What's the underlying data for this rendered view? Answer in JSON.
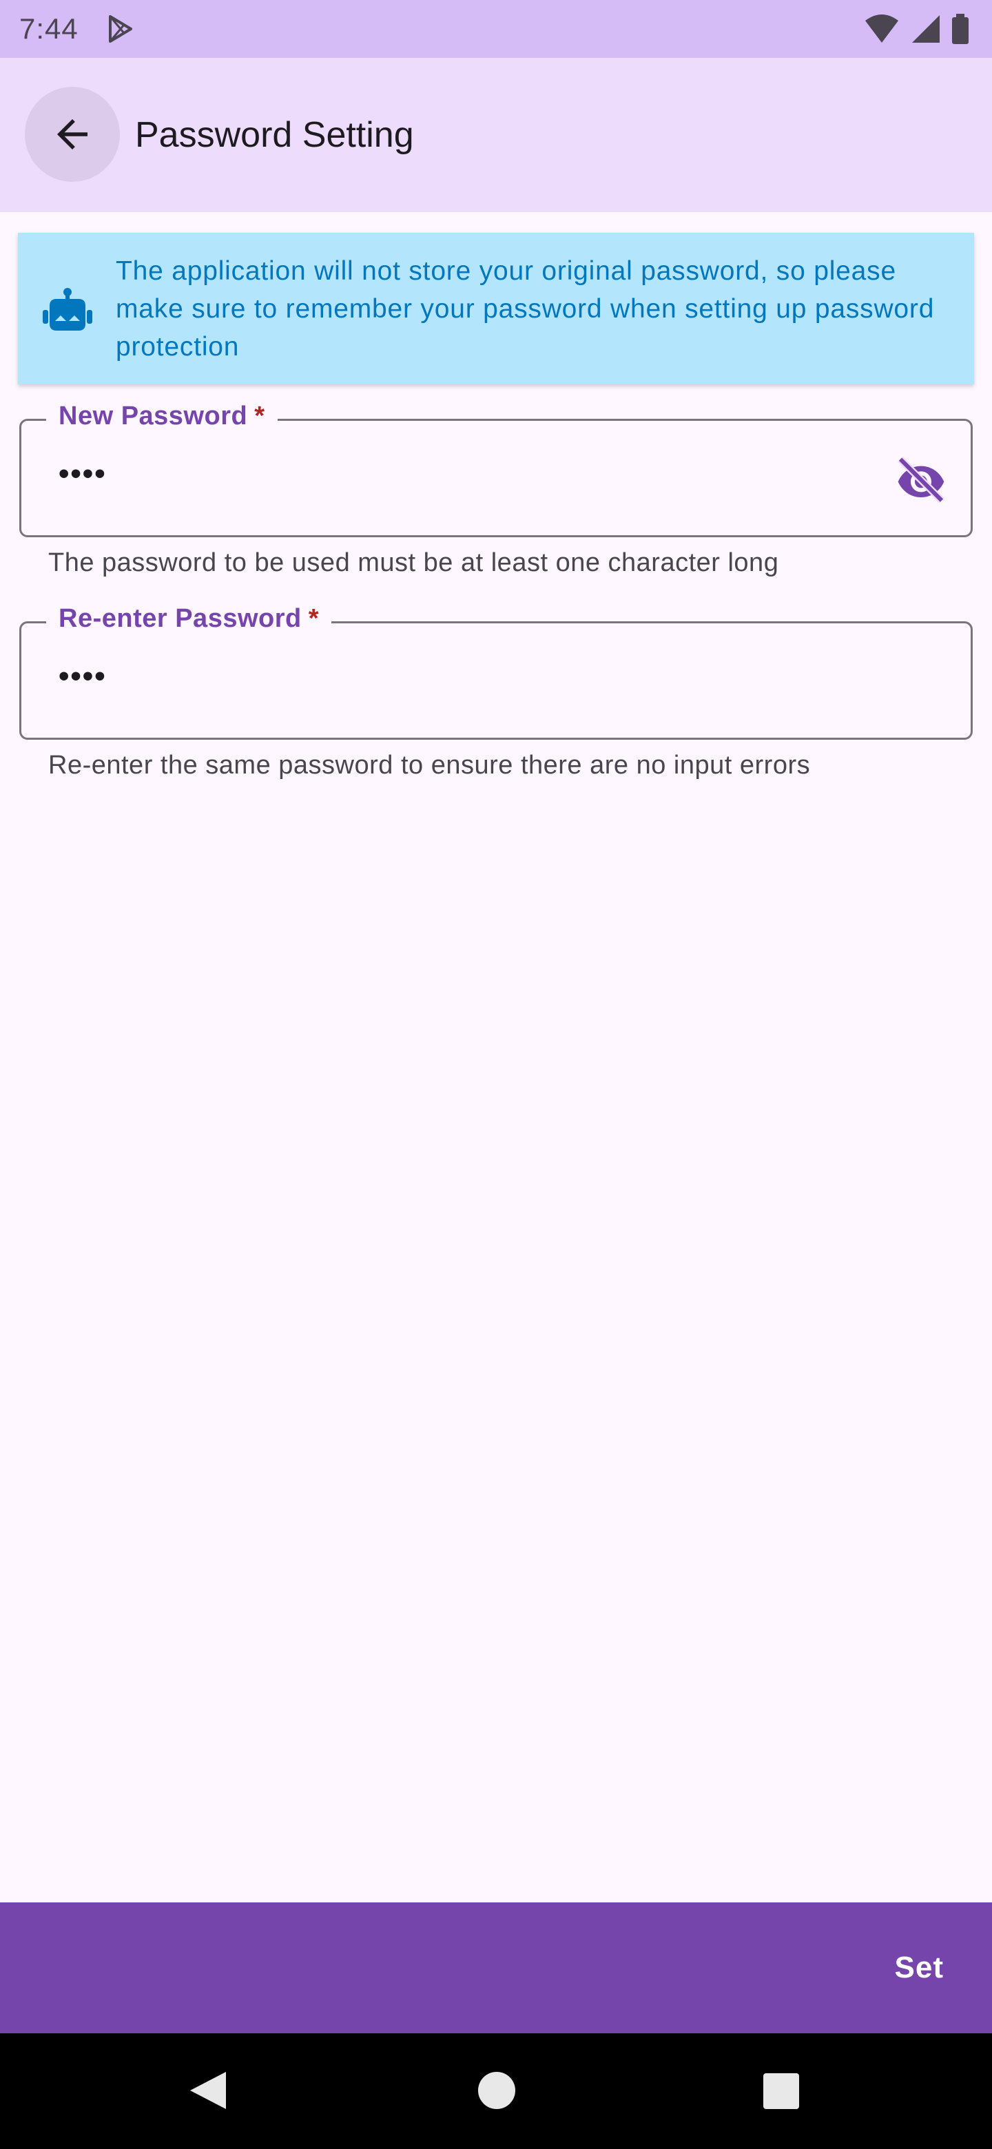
{
  "status_bar": {
    "time": "7:44"
  },
  "app_bar": {
    "title": "Password Setting"
  },
  "info_banner": {
    "text": "The application will not store your original password, so please make sure to remember your password when setting up password protection"
  },
  "fields": {
    "new_password": {
      "label": "New Password",
      "required_mark": "*",
      "value": "••••",
      "helper": "The password to be used must be at least one character long"
    },
    "reenter_password": {
      "label": "Re-enter Password",
      "required_mark": "*",
      "value": "••••",
      "helper": "Re-enter the same password to ensure there are no input errors"
    }
  },
  "actions": {
    "set_label": "Set"
  },
  "colors": {
    "primary": "#7645AC",
    "status_bar": "#D6BCF7",
    "app_bar": "#EEDCFD",
    "info_bg": "#B3E5FC",
    "info_text": "#0277BD",
    "error": "#B3261E",
    "background": "#FEF7FF"
  },
  "icons": {
    "back": "arrow-left-icon",
    "info": "robot-icon",
    "visibility": "eye-off-icon",
    "status_play": "play-store-icon",
    "wifi": "wifi-icon",
    "signal": "signal-icon",
    "battery": "battery-icon"
  }
}
